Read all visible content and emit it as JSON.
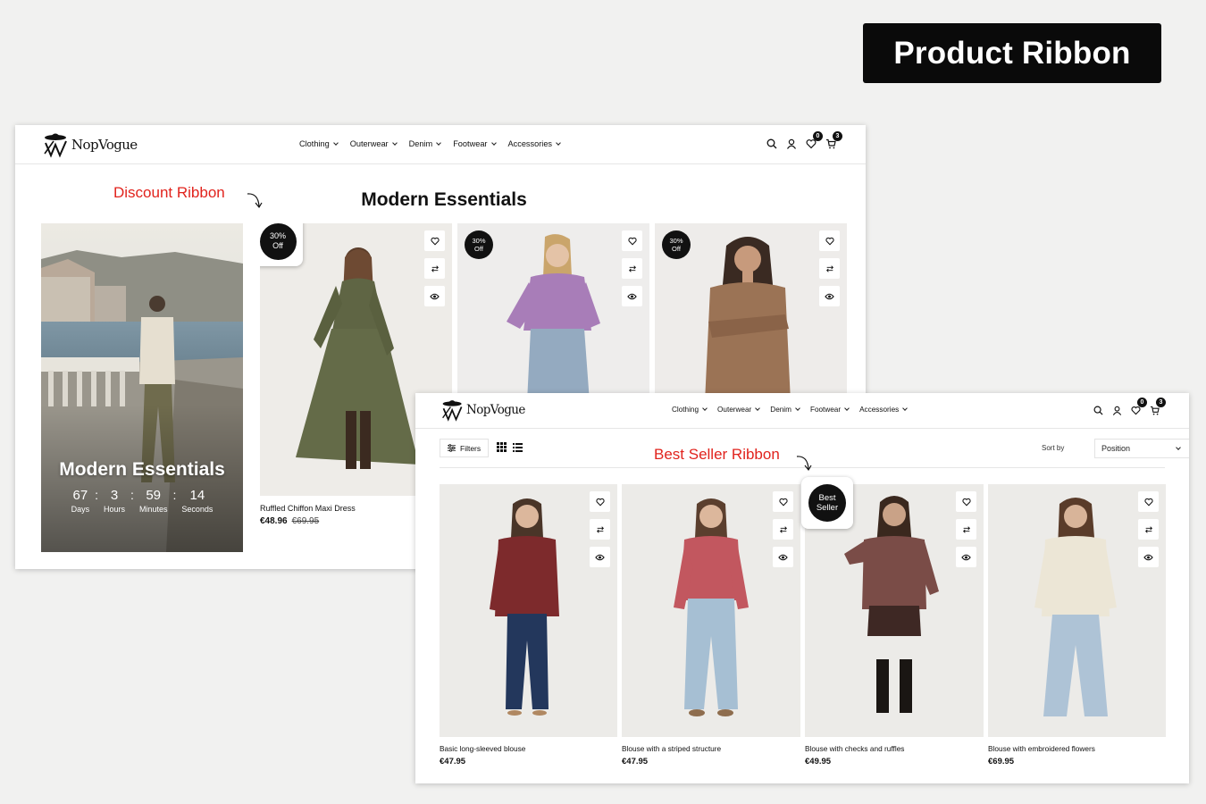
{
  "banner_title": "Product Ribbon",
  "brand": "NopVogue",
  "nav": [
    "Clothing",
    "Outerwear",
    "Denim",
    "Footwear",
    "Accessories"
  ],
  "header_counts": {
    "wishlist": "0",
    "cart": "3"
  },
  "annotations": {
    "discount": "Discount Ribbon",
    "bestseller": "Best Seller Ribbon"
  },
  "colors": {
    "accent_red": "#e1231d",
    "ribbon_black": "#111111",
    "page_bg": "#f1f1f0"
  },
  "screen1": {
    "section_title": "Modern Essentials",
    "promo": {
      "title": "Modern Essentials",
      "countdown": [
        {
          "value": "67",
          "label": "Days"
        },
        {
          "value": "3",
          "label": "Hours"
        },
        {
          "value": "59",
          "label": "Minutes"
        },
        {
          "value": "14",
          "label": "Seconds"
        }
      ]
    },
    "products": [
      {
        "ribbon": "30%\nOff",
        "name": "Ruffled Chiffon Maxi Dress",
        "price": "€48.96",
        "old_price": "€69.95"
      },
      {
        "ribbon": "30%\nOff",
        "name": "",
        "price": "",
        "old_price": ""
      },
      {
        "ribbon": "30%\nOff",
        "name": "",
        "price": "",
        "old_price": ""
      }
    ]
  },
  "screen2": {
    "filters_label": "Filters",
    "sort_label": "Sort by",
    "sort_value": "Position",
    "products": [
      {
        "name": "Basic long-sleeved blouse",
        "price": "€47.95",
        "ribbon": ""
      },
      {
        "name": "Blouse with a striped structure",
        "price": "€47.95",
        "ribbon": ""
      },
      {
        "name": "Blouse with checks and ruffles",
        "price": "€49.95",
        "ribbon": "Best\nSeller"
      },
      {
        "name": "Blouse with embroidered flowers",
        "price": "€69.95",
        "ribbon": ""
      }
    ]
  },
  "icons": [
    "search-icon",
    "user-icon",
    "heart-icon",
    "cart-icon",
    "compare-icon",
    "eye-icon",
    "filter-icon",
    "grid-view-icon",
    "list-view-icon",
    "chevron-down-icon"
  ]
}
